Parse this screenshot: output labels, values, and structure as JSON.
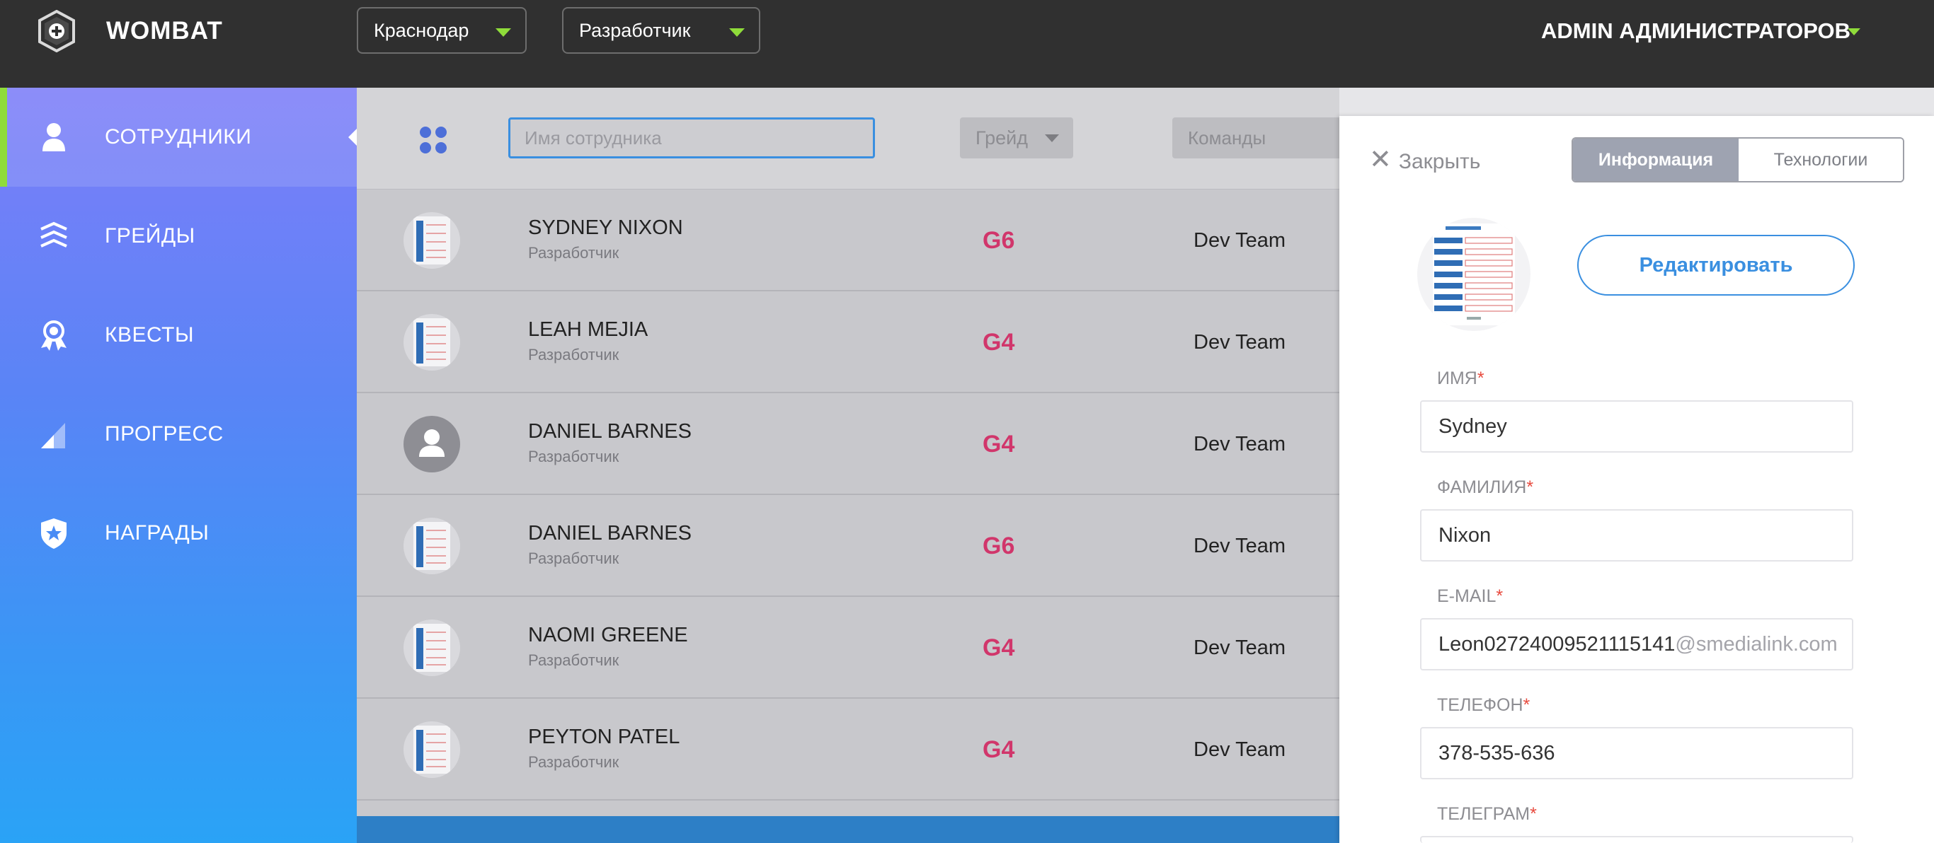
{
  "header": {
    "brand": "WOMBAT",
    "city_select": "Краснодар",
    "role_select": "Разработчик",
    "user_name": "ADMIN АДМИНИСТРАТОРОВ"
  },
  "sidebar": {
    "items": [
      {
        "label": "СОТРУДНИКИ",
        "icon": "person-icon",
        "active": true
      },
      {
        "label": "ГРЕЙДЫ",
        "icon": "chevrons-icon",
        "active": false
      },
      {
        "label": "КВЕСТЫ",
        "icon": "ribbon-award-icon",
        "active": false
      },
      {
        "label": "ПРОГРЕСС",
        "icon": "progress-signal-icon",
        "active": false
      },
      {
        "label": "НАГРАДЫ",
        "icon": "star-shield-icon",
        "active": false
      }
    ],
    "accent_color": "#8fdc3a"
  },
  "filters": {
    "search_placeholder": "Имя сотрудника",
    "grade_label": "Грейд",
    "teams_label": "Команды"
  },
  "employees": [
    {
      "name": "SYDNEY NIXON",
      "role": "Разработчик",
      "grade": "G6",
      "team": "Dev Team",
      "avatar": "document"
    },
    {
      "name": "LEAH MEJIA",
      "role": "Разработчик",
      "grade": "G4",
      "team": "Dev Team",
      "avatar": "document"
    },
    {
      "name": "DANIEL BARNES",
      "role": "Разработчик",
      "grade": "G4",
      "team": "Dev Team",
      "avatar": "person"
    },
    {
      "name": "DANIEL BARNES",
      "role": "Разработчик",
      "grade": "G6",
      "team": "Dev Team",
      "avatar": "document"
    },
    {
      "name": "NAOMI GREENE",
      "role": "Разработчик",
      "grade": "G4",
      "team": "Dev Team",
      "avatar": "document"
    },
    {
      "name": "PEYTON PATEL",
      "role": "Разработчик",
      "grade": "G4",
      "team": "Dev Team",
      "avatar": "document"
    }
  ],
  "panel": {
    "close_label": "Закрыть",
    "tabs": [
      "Информация",
      "Технологии"
    ],
    "edit_label": "Редактировать",
    "fields": {
      "first_name_label": "ИМЯ",
      "first_name": "Sydney",
      "last_name_label": "ФАМИЛИЯ",
      "last_name": "Nixon",
      "email_label": "E-MAIL",
      "email_local": "Leon02724009521115141",
      "email_domain": "@smedialink.com",
      "phone_label": "ТЕЛЕФОН",
      "phone": "378-535-636",
      "telegram_label": "ТЕЛЕГРАМ"
    },
    "required_mark": "*"
  }
}
